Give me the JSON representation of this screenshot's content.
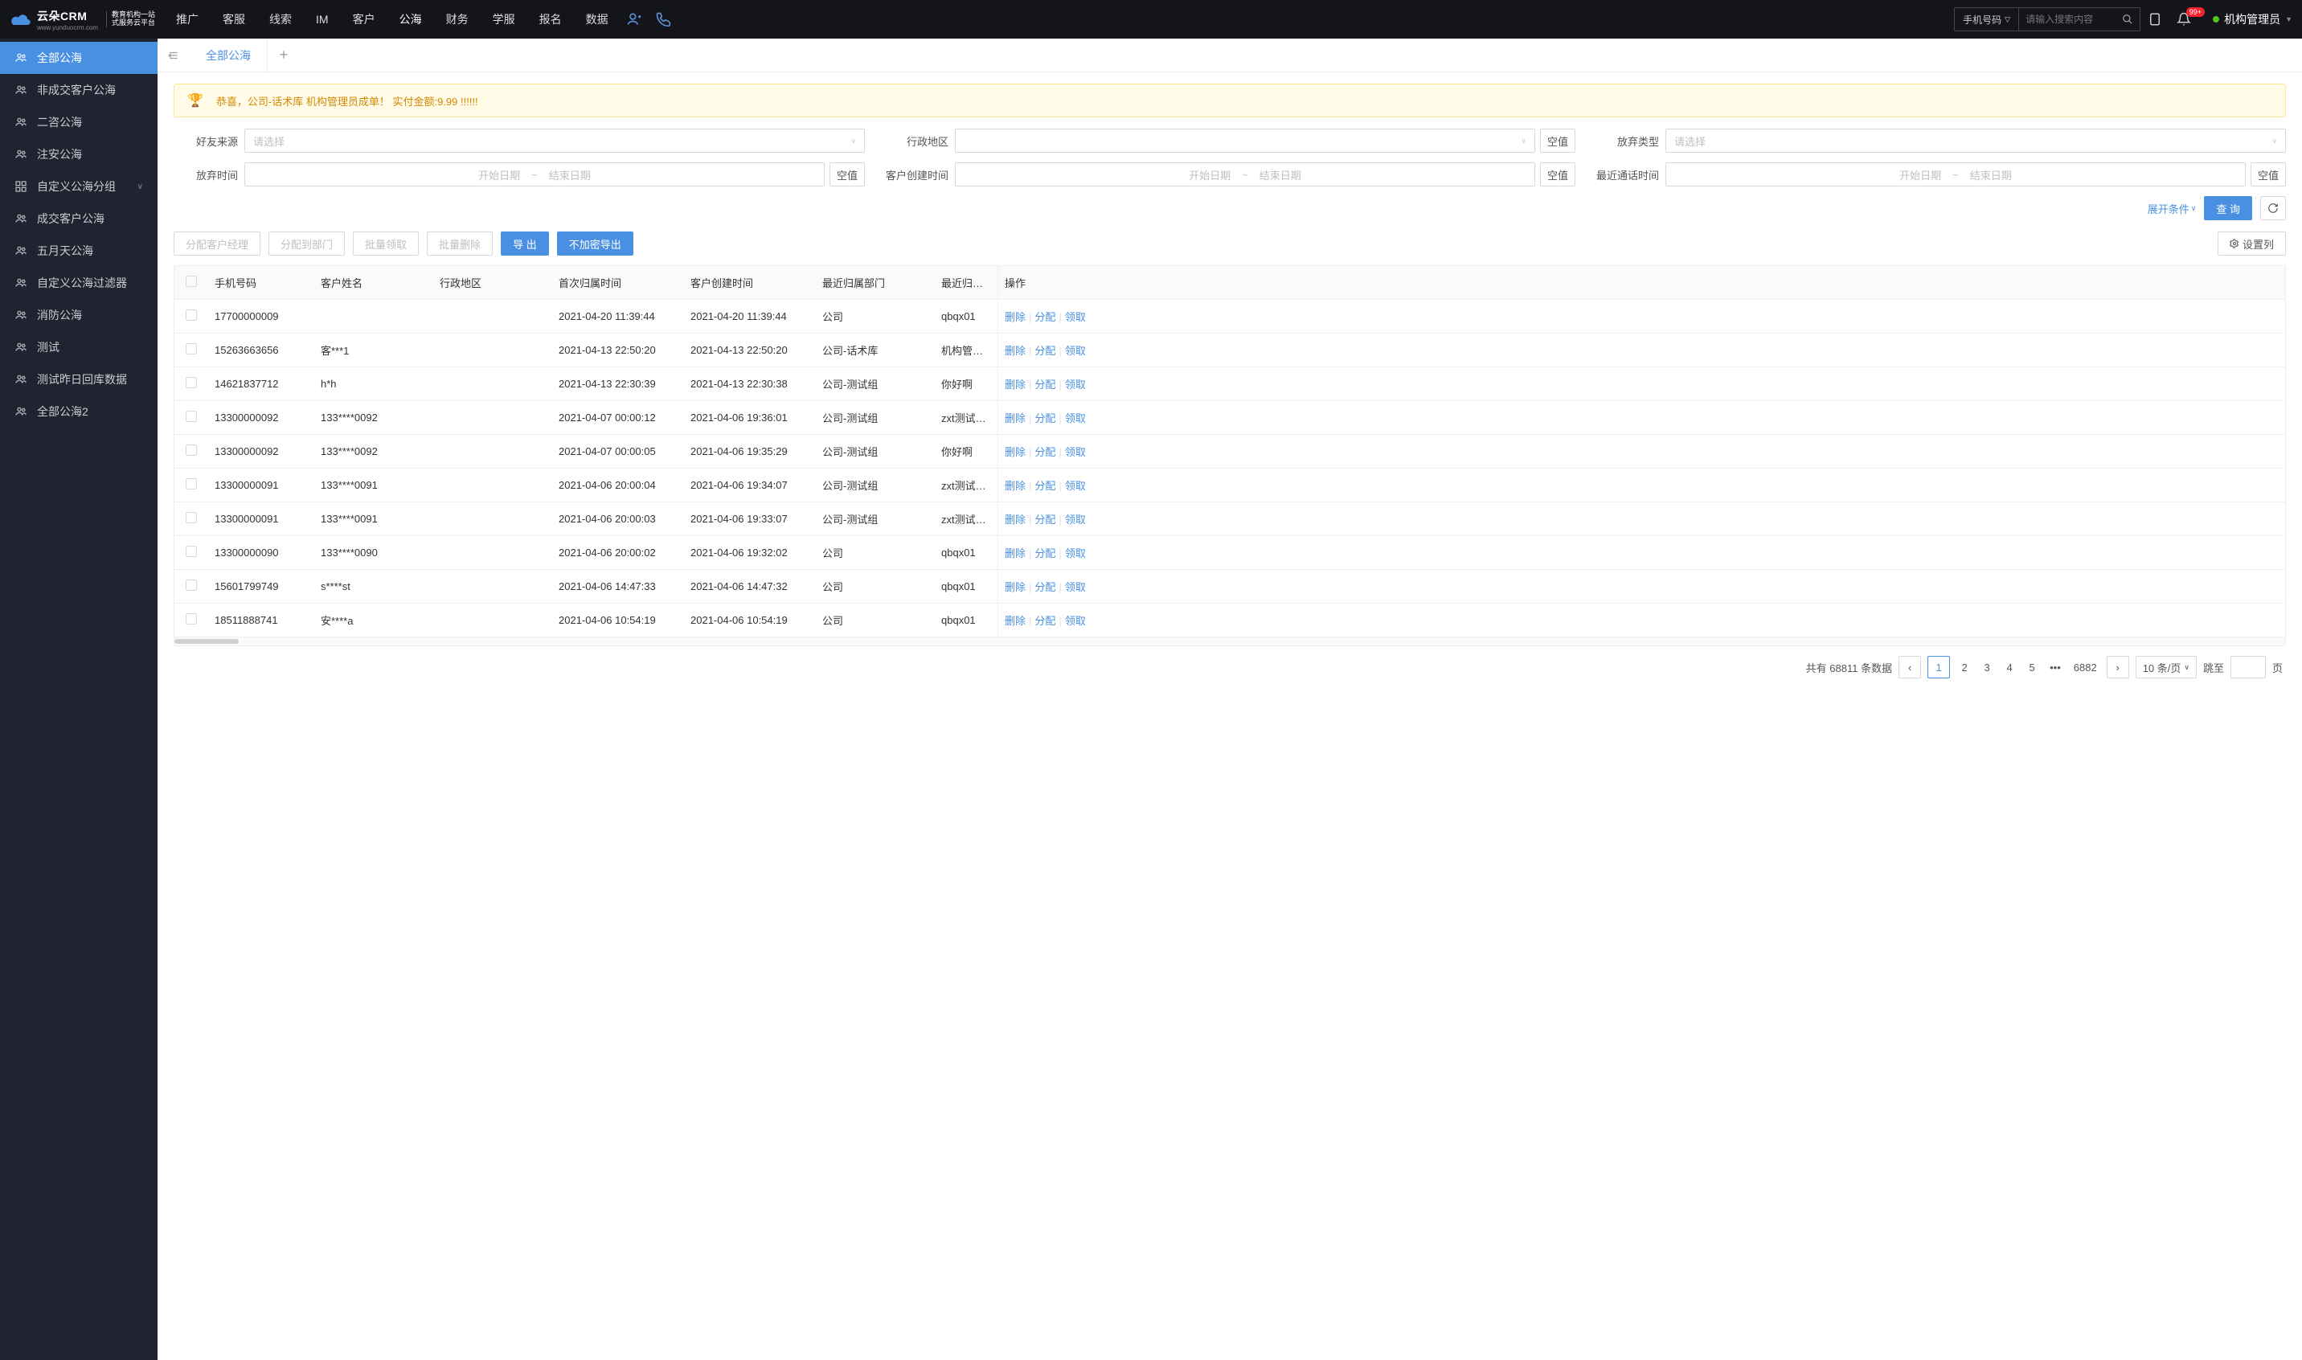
{
  "header": {
    "logo_text": "云朵CRM",
    "logo_url": "www.yunduocrm.com",
    "logo_sub1": "教育机构一站",
    "logo_sub2": "式服务云平台",
    "nav": [
      "推广",
      "客服",
      "线索",
      "IM",
      "客户",
      "公海",
      "财务",
      "学服",
      "报名",
      "数据"
    ],
    "active_nav": "公海",
    "search_select": "手机号码",
    "search_placeholder": "请输入搜索内容",
    "badge": "99+",
    "user": "机构管理员"
  },
  "sidebar": {
    "items": [
      {
        "label": "全部公海",
        "active": true,
        "icon": "users"
      },
      {
        "label": "非成交客户公海",
        "icon": "users"
      },
      {
        "label": "二咨公海",
        "icon": "users"
      },
      {
        "label": "注安公海",
        "icon": "users"
      },
      {
        "label": "自定义公海分组",
        "icon": "grid",
        "chevron": true
      },
      {
        "label": "成交客户公海",
        "icon": "users"
      },
      {
        "label": "五月天公海",
        "icon": "users"
      },
      {
        "label": "自定义公海过滤器",
        "icon": "users"
      },
      {
        "label": "消防公海",
        "icon": "users"
      },
      {
        "label": "测试",
        "icon": "users"
      },
      {
        "label": "测试昨日回库数据",
        "icon": "users"
      },
      {
        "label": "全部公海2",
        "icon": "users"
      }
    ]
  },
  "tabs": {
    "active": "全部公海"
  },
  "banner": "恭喜，公司-话术库  机构管理员成单！  实付金额:9.99 !!!!!!",
  "filters": {
    "friend_source": {
      "label": "好友来源",
      "placeholder": "请选择"
    },
    "admin_region": {
      "label": "行政地区",
      "empty_btn": "空值"
    },
    "abandon_type": {
      "label": "放弃类型",
      "placeholder": "请选择"
    },
    "abandon_time": {
      "label": "放弃时间",
      "start": "开始日期",
      "end": "结束日期",
      "empty_btn": "空值"
    },
    "create_time": {
      "label": "客户创建时间",
      "start": "开始日期",
      "end": "结束日期",
      "empty_btn": "空值"
    },
    "call_time": {
      "label": "最近通话时间",
      "start": "开始日期",
      "end": "结束日期",
      "empty_btn": "空值"
    },
    "expand": "展开条件",
    "query": "查 询"
  },
  "toolbar": {
    "assign_manager": "分配客户经理",
    "assign_dept": "分配到部门",
    "batch_claim": "批量领取",
    "batch_delete": "批量删除",
    "export": "导 出",
    "export_plain": "不加密导出",
    "set_cols": "设置列"
  },
  "table": {
    "columns": {
      "phone": "手机号码",
      "name": "客户姓名",
      "region": "行政地区",
      "first_time": "首次归属时间",
      "create_time": "客户创建时间",
      "dept": "最近归属部门",
      "person": "最近归属人",
      "ops": "操作"
    },
    "ops": {
      "delete": "删除",
      "assign": "分配",
      "claim": "领取"
    },
    "rows": [
      {
        "phone": "17700000009",
        "name": "",
        "region": "",
        "first": "2021-04-20 11:39:44",
        "create": "2021-04-20 11:39:44",
        "dept": "公司",
        "person": "qbqx01"
      },
      {
        "phone": "15263663656",
        "name": "客***1",
        "region": "",
        "first": "2021-04-13 22:50:20",
        "create": "2021-04-13 22:50:20",
        "dept": "公司-话术库",
        "person": "机构管理员"
      },
      {
        "phone": "14621837712",
        "name": "h*h",
        "region": "",
        "first": "2021-04-13 22:30:39",
        "create": "2021-04-13 22:30:38",
        "dept": "公司-测试组",
        "person": "你好啊"
      },
      {
        "phone": "13300000092",
        "name": "133****0092",
        "region": "",
        "first": "2021-04-07 00:00:12",
        "create": "2021-04-06 19:36:01",
        "dept": "公司-测试组",
        "person": "zxt测试导入"
      },
      {
        "phone": "13300000092",
        "name": "133****0092",
        "region": "",
        "first": "2021-04-07 00:00:05",
        "create": "2021-04-06 19:35:29",
        "dept": "公司-测试组",
        "person": "你好啊"
      },
      {
        "phone": "13300000091",
        "name": "133****0091",
        "region": "",
        "first": "2021-04-06 20:00:04",
        "create": "2021-04-06 19:34:07",
        "dept": "公司-测试组",
        "person": "zxt测试导入"
      },
      {
        "phone": "13300000091",
        "name": "133****0091",
        "region": "",
        "first": "2021-04-06 20:00:03",
        "create": "2021-04-06 19:33:07",
        "dept": "公司-测试组",
        "person": "zxt测试导入"
      },
      {
        "phone": "13300000090",
        "name": "133****0090",
        "region": "",
        "first": "2021-04-06 20:00:02",
        "create": "2021-04-06 19:32:02",
        "dept": "公司",
        "person": "qbqx01"
      },
      {
        "phone": "15601799749",
        "name": "s****st",
        "region": "",
        "first": "2021-04-06 14:47:33",
        "create": "2021-04-06 14:47:32",
        "dept": "公司",
        "person": "qbqx01"
      },
      {
        "phone": "18511888741",
        "name": "安****a",
        "region": "",
        "first": "2021-04-06 10:54:19",
        "create": "2021-04-06 10:54:19",
        "dept": "公司",
        "person": "qbqx01"
      }
    ]
  },
  "pagination": {
    "total_label_prefix": "共有",
    "total": "68811",
    "total_label_suffix": "条数据",
    "pages": [
      "1",
      "2",
      "3",
      "4",
      "5"
    ],
    "last": "6882",
    "per_page": "10 条/页",
    "jump_label": "跳至",
    "jump_suffix": "页"
  }
}
